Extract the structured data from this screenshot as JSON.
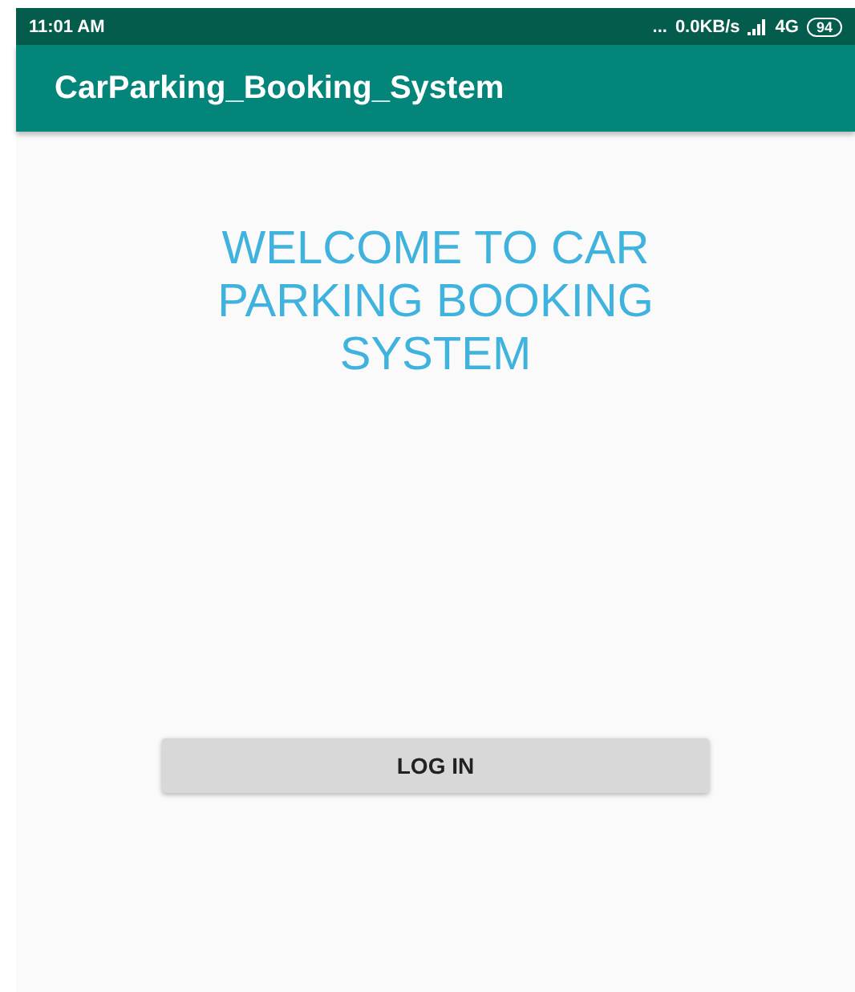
{
  "status_bar": {
    "time": "11:01 AM",
    "dots": "...",
    "speed": "0.0KB/s",
    "network": "4G",
    "battery": "94"
  },
  "app_bar": {
    "title": "CarParking_Booking_System"
  },
  "welcome": "WELCOME TO CAR PARKING BOOKING SYSTEM",
  "buttons": [
    {
      "label": "LOG IN"
    }
  ]
}
